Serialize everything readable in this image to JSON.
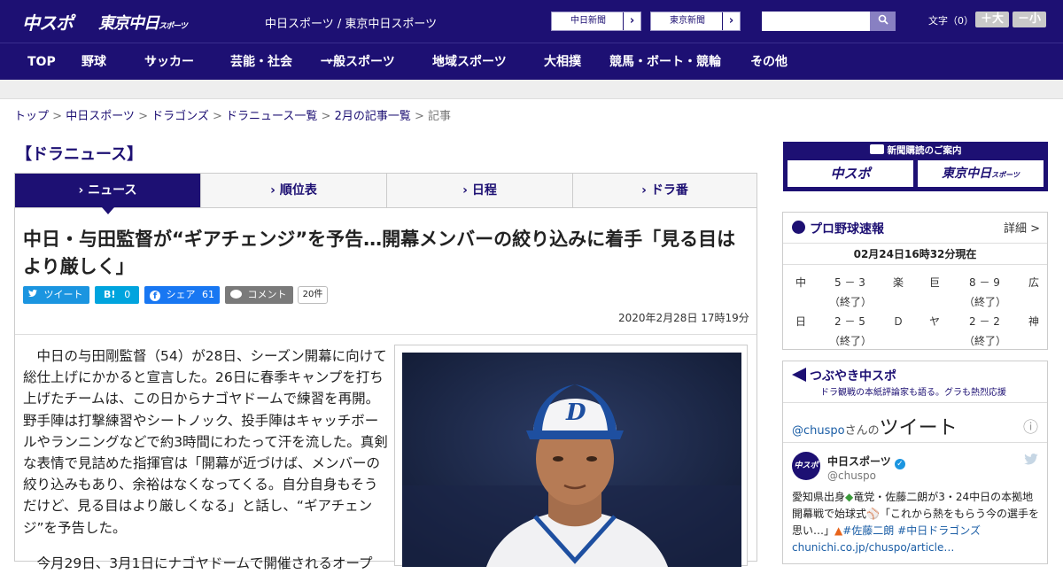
{
  "header": {
    "logo_chuspo": "中スポ",
    "logo_tokyo": "東京中日",
    "logo_tokyo_small": "スポーツ",
    "site_links": "中日スポーツ / 東京中日スポーツ",
    "paper_btn_1": "中日新聞",
    "paper_btn_2": "東京新聞",
    "search_icon": "search-icon",
    "font_size_label": "文字（0）",
    "font_plus": "＋大",
    "font_minus": "－小"
  },
  "nav": {
    "items": [
      "TOP",
      "野球",
      "サッカー",
      "芸能・社会",
      "一般スポーツ",
      "地域スポーツ",
      "大相撲",
      "競馬・ボート・競輪",
      "その他"
    ],
    "chevron": "∨"
  },
  "breadcrumb": {
    "items": [
      "トップ",
      "中日スポーツ",
      "ドラゴンズ",
      "ドラニュース一覧",
      "2月の記事一覧"
    ],
    "current": "記事",
    "sep": " > "
  },
  "section_title": "【ドラニュース】",
  "tabs": [
    "ニュース",
    "順位表",
    "日程",
    "ドラ番"
  ],
  "article": {
    "title": "中日・与田監督が“ギアチェンジ”を予告…開幕メンバーの絞り込みに着手「見る目はより厳しく」",
    "share": {
      "tweet": "ツイート",
      "hatena": "B!",
      "hatena_count": "0",
      "facebook": "シェア",
      "facebook_count": "61",
      "comment": "コメント",
      "comment_count": "20件"
    },
    "date": "2020年2月28日 17時19分",
    "body_p1": "　中日の与田剛監督（54）が28日、シーズン開幕に向けて総仕上げにかかると宣言した。26日に春季キャンプを打ち上げたチームは、この日からナゴヤドームで練習を再開。野手陣は打撃練習やシートノック、投手陣はキャッチボールやランニングなどで約3時間にわたって汗を流した。真剣な表情で見詰めた指揮官は「開幕が近づけば、メンバーの絞り込みもあり、余裕はなくなってくる。自分自身もそうだけど、見る目はより厳しくなる」と話し、“ギアチェンジ”を予告した。",
    "body_p2": "　今月29日、3月1日にナゴヤドームで開催されるオープ"
  },
  "sidebar": {
    "subscribe": {
      "title": "新聞購読のご案内",
      "btn_1": "中スポ",
      "btn_2": "東京中日",
      "btn_2_small": "スポーツ"
    },
    "scores": {
      "title": "プロ野球速報",
      "detail": "詳細 >",
      "datetime": "02月24日16時32分現在",
      "games": [
        {
          "home": "中",
          "score": "5 － 3",
          "away": "楽",
          "status": "（終了）"
        },
        {
          "home": "巨",
          "score": "8 － 9",
          "away": "広",
          "status": "（終了）"
        },
        {
          "home": "日",
          "score": "2 － 5",
          "away": "Ｄ",
          "status": "（終了）"
        },
        {
          "home": "ヤ",
          "score": "2 － 2",
          "away": "神",
          "status": "（終了）"
        }
      ]
    },
    "twitter": {
      "title": "つぶやき中スポ",
      "subtitle": "ドラ観戦の本紙評論家も語る。グラも熱烈応援",
      "handle_link": "@chuspo",
      "handle_suffix": "さんの",
      "tweets_label": "ツイート",
      "info_icon": "ⓘ",
      "account_name": "中日スポーツ",
      "account_handle": "@chuspo",
      "avatar_text": "中スポ",
      "text_1": "愛知県出身",
      "text_2": "竜党・佐藤二朗が3・24中日の本拠地開幕戦で始球式",
      "text_3": "「これから熱をもらう今の選手を思い…」",
      "hashtag_1": "#佐藤二朗",
      "hashtag_2": "#中日ドラゴンズ",
      "link": "chunichi.co.jp/chuspo/article…"
    }
  }
}
